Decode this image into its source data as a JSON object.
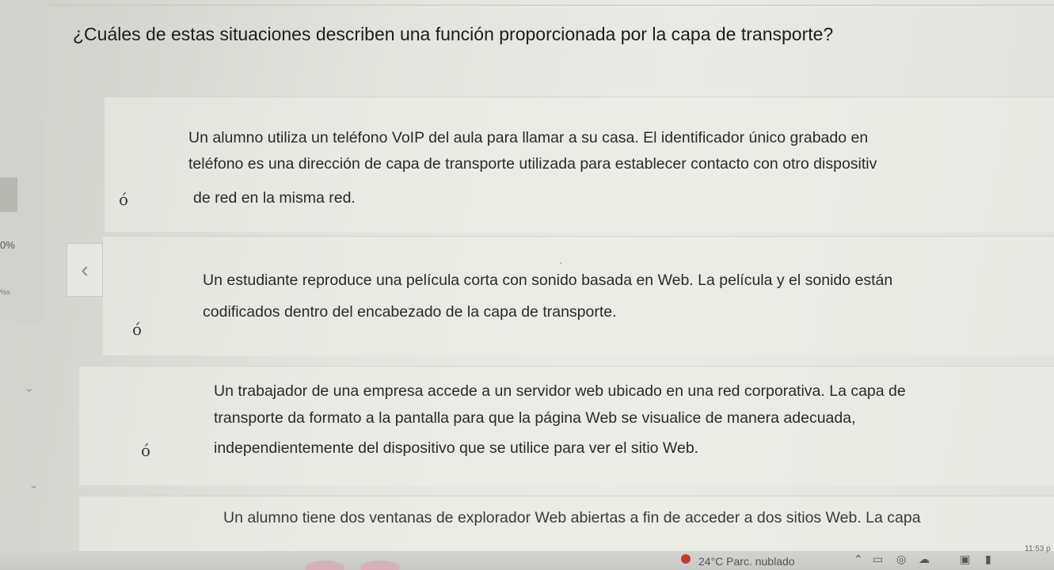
{
  "question": "¿Cuáles de estas situaciones describen una función proporcionada por la capa de transporte?",
  "sidebar": {
    "progress": "0%",
    "tiny_label": "%s"
  },
  "options": [
    {
      "radio": "ó",
      "lines": [
        "Un alumno utiliza un teléfono VoIP del aula para llamar a su casa. El identificador único grabado en",
        "teléfono es una dirección de capa de transporte utilizada para establecer contacto con otro dispositiv",
        "de red en la misma red."
      ]
    },
    {
      "radio": "ó",
      "lines": [
        "Un estudiante reproduce una película corta con sonido basada en Web. La película y el sonido están",
        "codificados dentro del encabezado de la capa de transporte."
      ]
    },
    {
      "radio": "ó",
      "lines": [
        "Un trabajador de una empresa accede a un servidor web ubicado en una red corporativa. La capa de",
        "transporte da formato a la pantalla para que la página Web se visualice de manera adecuada,",
        "independientemente del dispositivo que se utilice para ver el sitio Web."
      ]
    },
    {
      "radio": "",
      "lines": [
        "Un alumno tiene dos ventanas de explorador Web abiertas a fin de acceder a dos sitios Web. La capa"
      ]
    }
  ],
  "taskbar": {
    "weather": "24°C  Parc. nublado",
    "clock": "11:53 p",
    "icons": [
      "chevron-up-icon",
      "speaker-icon",
      "wifi-icon",
      "cloud-icon",
      "camera-icon",
      "battery-icon"
    ]
  }
}
